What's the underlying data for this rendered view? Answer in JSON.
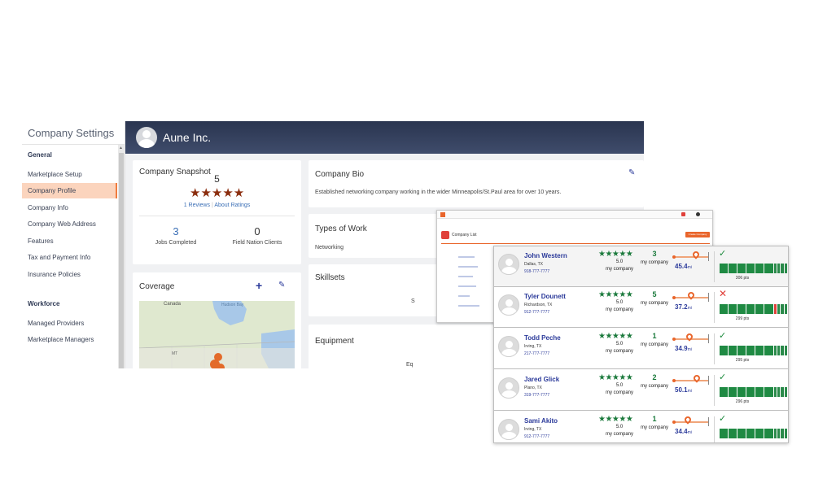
{
  "sidebar": {
    "title": "Company Settings",
    "sections": [
      {
        "label": "General",
        "items": [
          "Marketplace Setup",
          "Company Profile",
          "Company Info",
          "Company Web Address",
          "Features",
          "Tax and Payment Info",
          "Insurance Policies"
        ]
      },
      {
        "label": "Workforce",
        "items": [
          "Managed Providers",
          "Marketplace Managers"
        ]
      }
    ],
    "active_item": "Company Profile"
  },
  "header": {
    "company_name": "Aune Inc."
  },
  "snapshot": {
    "title": "Company Snapshot",
    "score": "5",
    "stars": "★★★★★",
    "reviews_link": "1 Reviews",
    "about_link": "About Ratings",
    "separator": "|",
    "jobs_completed": "3",
    "jobs_completed_label": "Jobs Completed",
    "clients": "0",
    "clients_label": "Field Nation Clients"
  },
  "coverage": {
    "title": "Coverage",
    "add_icon": "+",
    "edit_icon": "✎",
    "map_labels": {
      "canada": "Canada",
      "hudson_bay": "Hudson Bay",
      "mt": "MT"
    }
  },
  "bio": {
    "title": "Company Bio",
    "edit_icon": "✎",
    "text": "Established networking company working in the wider Minneapolis/St.Paul area for over 10 years."
  },
  "types_of_work": {
    "title": "Types of Work",
    "value": "Networking"
  },
  "skillsets": {
    "title": "Skillsets",
    "trailing": "S"
  },
  "equipment": {
    "title": "Equipment",
    "trailing": "Eq"
  },
  "mini_window": {
    "title": "Company List",
    "button": "Create Company"
  },
  "providers": [
    {
      "name": "John Western",
      "city": "Dallas, TX",
      "phone": "918-777-7777",
      "stars": "★★★★★",
      "rating": "5.0",
      "rating_label": "my company",
      "jobs": "3",
      "jobs_label": "my company",
      "distance": "45.4",
      "unit": "mi",
      "status": "check",
      "points": "306 pts",
      "bar": [
        "g",
        "g",
        "g",
        "g",
        "g",
        "g",
        "g",
        "g",
        "g",
        "g"
      ]
    },
    {
      "name": "Tyler Dounett",
      "city": "Richardson, TX",
      "phone": "912-777-7777",
      "stars": "★★★★★",
      "rating": "5.0",
      "rating_label": "my company",
      "jobs": "5",
      "jobs_label": "my company",
      "distance": "37.2",
      "unit": "mi",
      "status": "cross",
      "points": "299 pts",
      "bar": [
        "g",
        "g",
        "g",
        "g",
        "g",
        "g",
        "r",
        "g",
        "g",
        "g"
      ]
    },
    {
      "name": "Todd Peche",
      "city": "Irving, TX",
      "phone": "217-777-7777",
      "stars": "★★★★★",
      "rating": "5.0",
      "rating_label": "my company",
      "jobs": "1",
      "jobs_label": "my company",
      "distance": "34.9",
      "unit": "mi",
      "status": "check",
      "points": "295 pts",
      "bar": [
        "g",
        "g",
        "g",
        "g",
        "g",
        "g",
        "g",
        "g",
        "g",
        "g"
      ]
    },
    {
      "name": "Jared Glick",
      "city": "Plano, TX",
      "phone": "319-777-7777",
      "stars": "★★★★★",
      "rating": "5.0",
      "rating_label": "my company",
      "jobs": "2",
      "jobs_label": "my company",
      "distance": "50.1",
      "unit": "mi",
      "status": "check",
      "points": "296 pts",
      "bar": [
        "g",
        "g",
        "g",
        "g",
        "g",
        "g",
        "g",
        "g",
        "g",
        "g"
      ]
    },
    {
      "name": "Sami Akito",
      "city": "Irving, TX",
      "phone": "912-777-7777",
      "stars": "★★★★★",
      "rating": "5.0",
      "rating_label": "my company",
      "jobs": "1",
      "jobs_label": "my company",
      "distance": "34.4",
      "unit": "mi",
      "status": "check",
      "points": "",
      "bar": [
        "g",
        "g",
        "g",
        "g",
        "g",
        "g",
        "g",
        "g",
        "g",
        "g"
      ]
    }
  ],
  "colors": {
    "accent": "#f07c3e",
    "header": "#2a3550",
    "star_snapshot": "#8b2d0e",
    "star_provider": "#1b7a3c",
    "link": "#2b3a9a"
  }
}
